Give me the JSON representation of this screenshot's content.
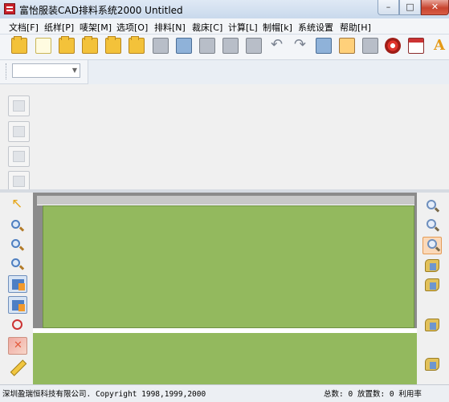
{
  "window": {
    "title": "富怡服装CAD排料系统2000 Untitled",
    "controls": {
      "minimize": "–",
      "maximize": "□",
      "close": "✕"
    }
  },
  "menu": {
    "items": [
      {
        "label": "文档[F]"
      },
      {
        "label": "纸样[P]"
      },
      {
        "label": "唛架[M]"
      },
      {
        "label": "选项[O]"
      },
      {
        "label": "排料[N]"
      },
      {
        "label": "裁床[C]"
      },
      {
        "label": "计算[L]"
      },
      {
        "label": "制帽[k]"
      },
      {
        "label": "系统设置"
      },
      {
        "label": "帮助[H]"
      }
    ]
  },
  "toolbar": {
    "icons": [
      "open-folder-icon",
      "new-document-icon",
      "open-folder-icon",
      "open-folder-icon",
      "open-folder-icon",
      "open-folder-icon",
      "tag-icon",
      "save-icon",
      "print-icon",
      "plotter-icon",
      "print-preview-icon",
      "undo-icon",
      "redo-icon",
      "pattern-icon",
      "tool-icon",
      "wrench-icon",
      "disc-icon",
      "calendar-icon",
      "font-icon"
    ]
  },
  "combo": {
    "value": "",
    "arrow": "▼"
  },
  "statusbar": {
    "company": "深圳盈瑞恒科技有限公司. Copyright 1998,1999,2000",
    "total_label": "总数:",
    "total_value": "0",
    "placed_label": "放置数:",
    "placed_value": "0",
    "usage_label": "利用率"
  }
}
